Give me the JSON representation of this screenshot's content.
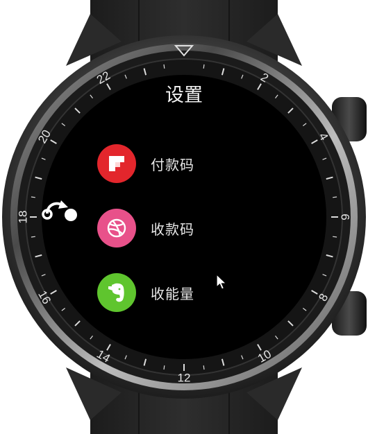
{
  "screen": {
    "title": "设置",
    "items": [
      {
        "label": "付款码",
        "icon": "flipboard-icon",
        "color": "#e3262c"
      },
      {
        "label": "收款码",
        "icon": "dribbble-icon",
        "color": "#e8518a"
      },
      {
        "label": "收能量",
        "icon": "evernote-icon",
        "color": "#5fc52e"
      }
    ]
  },
  "bezel": {
    "numbers": [
      "2",
      "4",
      "6",
      "8",
      "10",
      "12",
      "14",
      "16",
      "18",
      "20",
      "22"
    ]
  },
  "colors": {
    "screen_bg": "#000000",
    "bezel_dark": "#1a1a1a",
    "case": "#2b2b2b",
    "strap": "#222222"
  },
  "controls": {
    "back": "back-icon",
    "pointer": "cursor-icon"
  }
}
